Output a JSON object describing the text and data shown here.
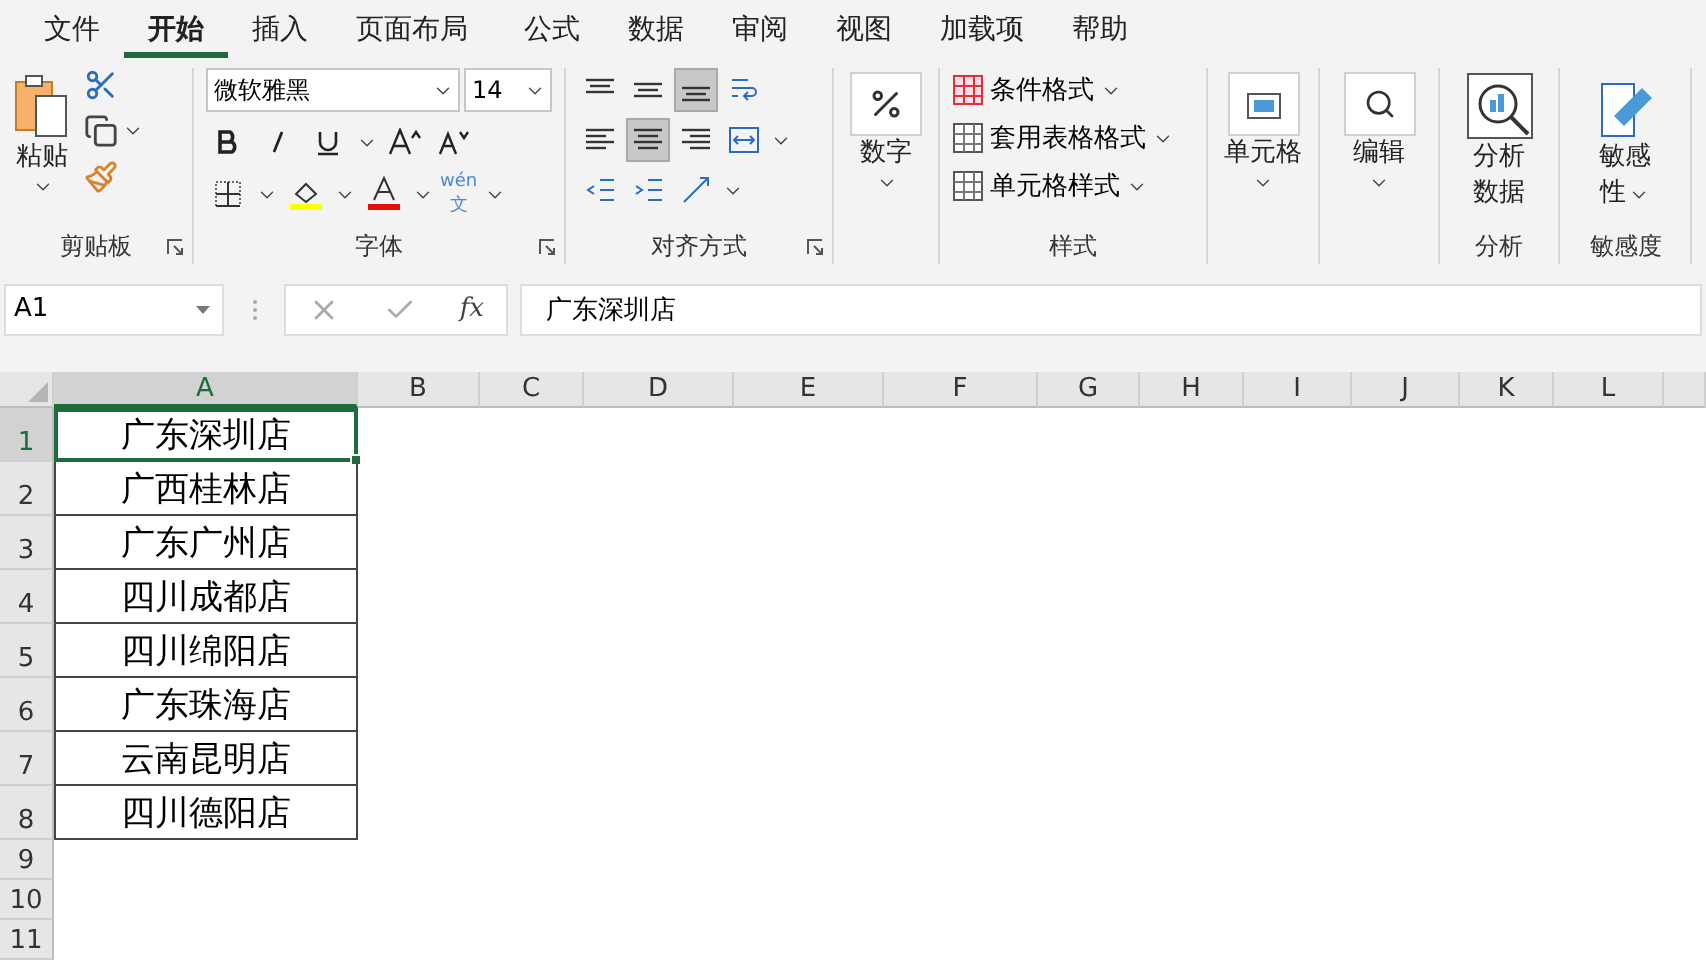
{
  "menu_tabs": [
    {
      "label": "文件",
      "selected": false
    },
    {
      "label": "开始",
      "selected": true
    },
    {
      "label": "插入",
      "selected": false
    },
    {
      "label": "页面布局",
      "selected": false
    },
    {
      "label": "公式",
      "selected": false
    },
    {
      "label": "数据",
      "selected": false
    },
    {
      "label": "审阅",
      "selected": false
    },
    {
      "label": "视图",
      "selected": false
    },
    {
      "label": "加载项",
      "selected": false
    },
    {
      "label": "帮助",
      "selected": false
    }
  ],
  "ribbon": {
    "clipboard": {
      "label": "剪贴板",
      "paste": "粘贴"
    },
    "font": {
      "label": "字体",
      "font_name": "微软雅黑",
      "font_size": "14",
      "phonetic_top": "wén",
      "phonetic_bottom": "文"
    },
    "alignment": {
      "label": "对齐方式",
      "vertical": [
        {
          "selected": false
        },
        {
          "selected": false
        },
        {
          "selected": true
        }
      ],
      "horizontal": [
        {
          "selected": false
        },
        {
          "selected": true
        },
        {
          "selected": false
        }
      ]
    },
    "number": {
      "button": "数字"
    },
    "styles": {
      "label": "样式",
      "items": [
        "条件格式",
        "套用表格格式",
        "单元格样式"
      ]
    },
    "cells": {
      "button": "单元格"
    },
    "editing": {
      "button": "编辑"
    },
    "analysis": {
      "label": "分析",
      "button": [
        "分析",
        "数据"
      ]
    },
    "sensitivity": {
      "label": "敏感度",
      "button": [
        "敏感",
        "性"
      ]
    }
  },
  "formula_bar": {
    "name_box": "A1",
    "fx": "fx",
    "formula": "广东深圳店"
  },
  "sheet": {
    "columns": [
      {
        "label": "A",
        "selected": true
      },
      {
        "label": "B",
        "selected": false
      },
      {
        "label": "C",
        "selected": false
      },
      {
        "label": "D",
        "selected": false
      },
      {
        "label": "E",
        "selected": false
      },
      {
        "label": "F",
        "selected": false
      },
      {
        "label": "G",
        "selected": false
      },
      {
        "label": "H",
        "selected": false
      },
      {
        "label": "I",
        "selected": false
      },
      {
        "label": "J",
        "selected": false
      },
      {
        "label": "K",
        "selected": false
      },
      {
        "label": "L",
        "selected": false
      }
    ],
    "rows": [
      {
        "number": "1",
        "value": "广东深圳店",
        "selected": true
      },
      {
        "number": "2",
        "value": "广西桂林店",
        "selected": false
      },
      {
        "number": "3",
        "value": "广东广州店",
        "selected": false
      },
      {
        "number": "4",
        "value": "四川成都店",
        "selected": false
      },
      {
        "number": "5",
        "value": "四川绵阳店",
        "selected": false
      },
      {
        "number": "6",
        "value": "广东珠海店",
        "selected": false
      },
      {
        "number": "7",
        "value": "云南昆明店",
        "selected": false
      },
      {
        "number": "8",
        "value": "四川德阳店",
        "selected": false
      },
      {
        "number": "9",
        "selected": false
      },
      {
        "number": "10",
        "selected": false
      },
      {
        "number": "11",
        "selected": false
      }
    ]
  }
}
